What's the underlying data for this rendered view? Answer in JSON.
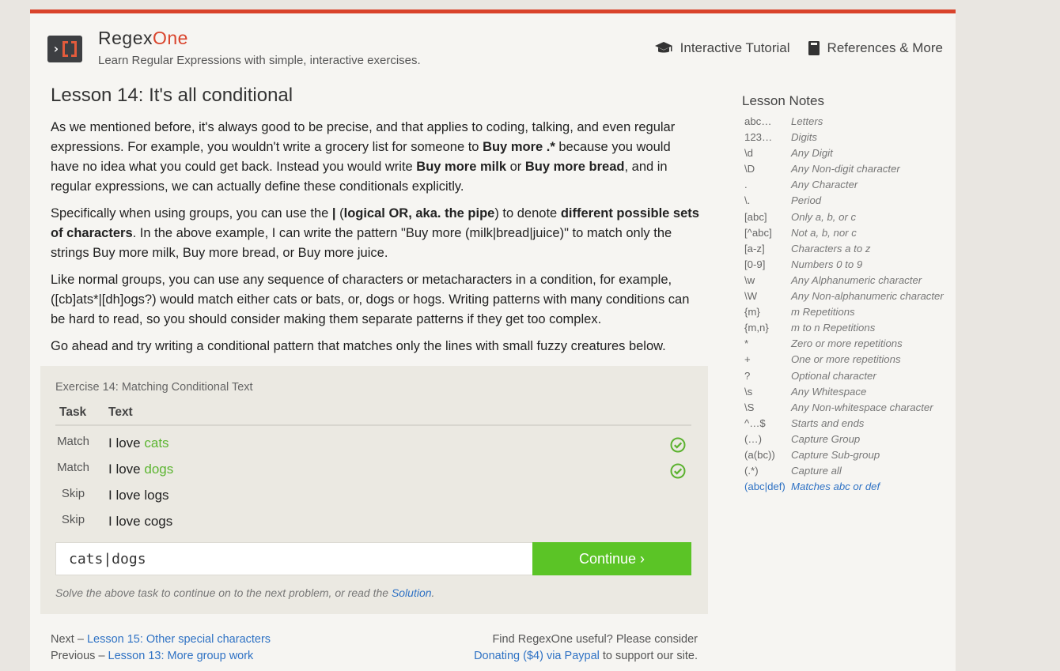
{
  "header": {
    "brand_main": "Regex",
    "brand_accent": "One",
    "tagline": "Learn Regular Expressions with simple, interactive exercises.",
    "nav": [
      {
        "label": "Interactive Tutorial",
        "icon": "graduation-cap-icon"
      },
      {
        "label": "References & More",
        "icon": "book-icon"
      }
    ]
  },
  "lesson": {
    "title": "Lesson 14: It's all conditional",
    "p1": {
      "a": "As we mentioned before, it's always good to be precise, and that applies to coding, talking, and even regular expressions. For example, you wouldn't write a grocery list for someone to ",
      "b1": "Buy more .*",
      "c": " because you would have no idea what you could get back. Instead you would write ",
      "b2": "Buy more milk",
      "d": " or ",
      "b3": "Buy more bread",
      "e": ", and in regular expressions, we can actually define these conditionals explicitly."
    },
    "p2": {
      "a": "Specifically when using groups, you can use the ",
      "b1": "|",
      "c": " (",
      "b2": "logical OR, aka. the pipe",
      "d": ") to denote ",
      "b3": "different possible sets of characters",
      "e": ". In the above example, I can write the pattern \"Buy more (milk|bread|juice)\" to match only the strings Buy more milk, Buy more bread, or Buy more juice."
    },
    "p3": "Like normal groups, you can use any sequence of characters or metacharacters in a condition, for example, ([cb]ats*|[dh]ogs?) would match either cats or bats, or, dogs or hogs. Writing patterns with many conditions can be hard to read, so you should consider making them separate patterns if they get too complex.",
    "p4": "Go ahead and try writing a conditional pattern that matches only the lines with small fuzzy creatures below."
  },
  "exercise": {
    "title": "Exercise 14: Matching Conditional Text",
    "col_task": "Task",
    "col_text": "Text",
    "rows": [
      {
        "task": "Match",
        "prefix": "I love ",
        "match": "cats",
        "done": true
      },
      {
        "task": "Match",
        "prefix": "I love ",
        "match": "dogs",
        "done": true
      },
      {
        "task": "Skip",
        "prefix": "I love logs",
        "match": "",
        "done": false
      },
      {
        "task": "Skip",
        "prefix": "I love cogs",
        "match": "",
        "done": false
      }
    ],
    "input_value": "cats|dogs",
    "continue_label": "Continue ›",
    "note_prefix": "Solve the above task to continue on to the next problem, or read the ",
    "note_link": "Solution",
    "note_suffix": "."
  },
  "footer": {
    "next_prefix": "Next – ",
    "next_link": "Lesson 15: Other special characters",
    "prev_prefix": "Previous – ",
    "prev_link": "Lesson 13: More group work",
    "support_line1": "Find RegexOne useful? Please consider",
    "support_link": "Donating ($4) via Paypal",
    "support_suffix": " to support our site."
  },
  "notes": {
    "title": "Lesson Notes",
    "items": [
      {
        "k": "abc…",
        "v": "Letters"
      },
      {
        "k": "123…",
        "v": "Digits"
      },
      {
        "k": "\\d",
        "v": "Any Digit"
      },
      {
        "k": "\\D",
        "v": "Any Non-digit character"
      },
      {
        "k": ".",
        "v": "Any Character"
      },
      {
        "k": "\\.",
        "v": "Period"
      },
      {
        "k": "[abc]",
        "v": "Only a, b, or c"
      },
      {
        "k": "[^abc]",
        "v": "Not a, b, nor c"
      },
      {
        "k": "[a-z]",
        "v": "Characters a to z"
      },
      {
        "k": "[0-9]",
        "v": "Numbers 0 to 9"
      },
      {
        "k": "\\w",
        "v": "Any Alphanumeric character"
      },
      {
        "k": "\\W",
        "v": "Any Non-alphanumeric character"
      },
      {
        "k": "{m}",
        "v": "m Repetitions"
      },
      {
        "k": "{m,n}",
        "v": "m to n Repetitions"
      },
      {
        "k": "*",
        "v": "Zero or more repetitions"
      },
      {
        "k": "+",
        "v": "One or more repetitions"
      },
      {
        "k": "?",
        "v": "Optional character"
      },
      {
        "k": "\\s",
        "v": "Any Whitespace"
      },
      {
        "k": "\\S",
        "v": "Any Non-whitespace character"
      },
      {
        "k": "^…$",
        "v": "Starts and ends"
      },
      {
        "k": "(…)",
        "v": "Capture Group"
      },
      {
        "k": "(a(bc))",
        "v": "Capture Sub-group"
      },
      {
        "k": "(.*)",
        "v": "Capture all"
      },
      {
        "k": "(abc|def)",
        "v": "Matches abc or def",
        "active": true
      }
    ]
  },
  "colors": {
    "accent": "#d9442c",
    "success": "#5bc426",
    "link": "#2f72c4"
  }
}
